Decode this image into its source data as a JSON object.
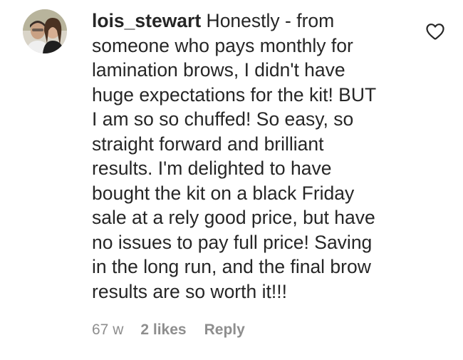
{
  "comment": {
    "username": "lois_stewart",
    "text": " Honestly - from\nsomeone who pays monthly for\nlamination brows, I didn't have\nhuge expectations for the kit! BUT\nI am so so chuffed! So easy, so\nstraight forward and brilliant\nresults. I'm delighted to have\nbought the kit on a black Friday\nsale at a rely good price, but have\nno issues to pay full price! Saving\nin the long run, and the final brow\nresults are so worth it!!!",
    "age": "67 w",
    "likes": "2 likes",
    "reply_label": "Reply",
    "avatar_icon": "profile-photo",
    "like_icon": "heart-outline-icon"
  },
  "colors": {
    "text": "#262626",
    "meta": "#8e8e8e",
    "background": "#ffffff"
  }
}
